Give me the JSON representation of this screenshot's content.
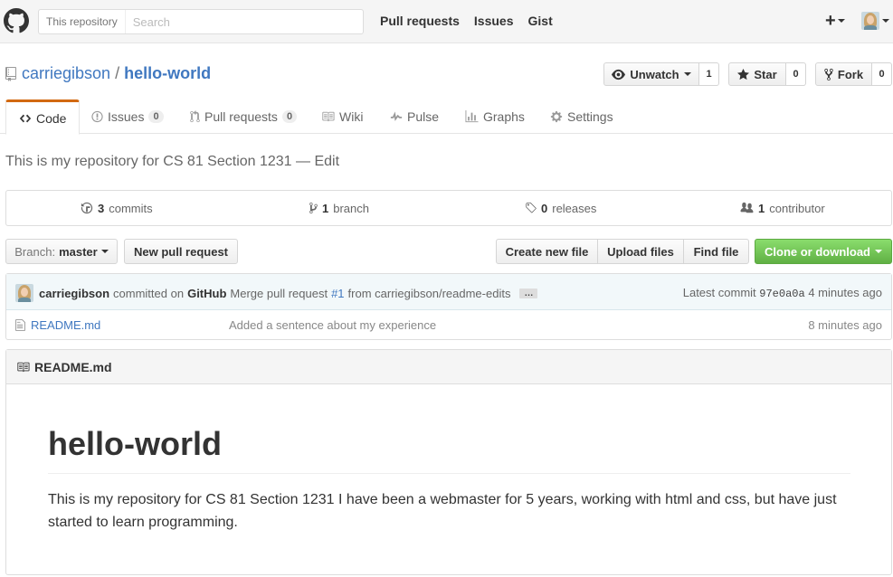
{
  "header": {
    "search_scope": "This repository",
    "search_placeholder": "Search",
    "nav": [
      "Pull requests",
      "Issues",
      "Gist"
    ],
    "plus": "+"
  },
  "repo": {
    "owner": "carriegibson",
    "separator": "/",
    "name": "hello-world",
    "watch_label": "Unwatch",
    "watch_count": "1",
    "star_label": "Star",
    "star_count": "0",
    "fork_label": "Fork",
    "fork_count": "0"
  },
  "tabs": {
    "code": "Code",
    "issues": "Issues",
    "issues_count": "0",
    "pulls": "Pull requests",
    "pulls_count": "0",
    "wiki": "Wiki",
    "pulse": "Pulse",
    "graphs": "Graphs",
    "settings": "Settings"
  },
  "description": "This is my repository for CS 81 Section 1231 — Edit",
  "summary": {
    "commits_num": "3",
    "commits_label": "commits",
    "branch_num": "1",
    "branch_label": "branch",
    "releases_num": "0",
    "releases_label": "releases",
    "contributor_num": "1",
    "contributor_label": "contributor"
  },
  "toolbar": {
    "branch_label": "Branch:",
    "branch_name": "master",
    "new_pr": "New pull request",
    "create_file": "Create new file",
    "upload_files": "Upload files",
    "find_file": "Find file",
    "clone": "Clone or download"
  },
  "commit": {
    "author": "carriegibson",
    "committed_on": "committed on",
    "platform": "GitHub",
    "message_prefix": "Merge pull request",
    "pr_link": "#1",
    "message_suffix": "from carriegibson/readme-edits",
    "ellipsis": "…",
    "latest_label": "Latest commit",
    "sha": "97e0a0a",
    "age": "4 minutes ago"
  },
  "files": [
    {
      "name": "README.md",
      "message": "Added a sentence about my experience",
      "age": "8 minutes ago"
    }
  ],
  "readme": {
    "filename": "README.md",
    "heading": "hello-world",
    "body": "This is my repository for CS 81 Section 1231 I have been a webmaster for 5 years, working with html and css, but have just started to learn programming."
  },
  "colors": {
    "link": "#4078c0",
    "tab_accent": "#d26911",
    "clone_green": "#6cc644",
    "commit_tease_bg": "#f2f8fa"
  }
}
